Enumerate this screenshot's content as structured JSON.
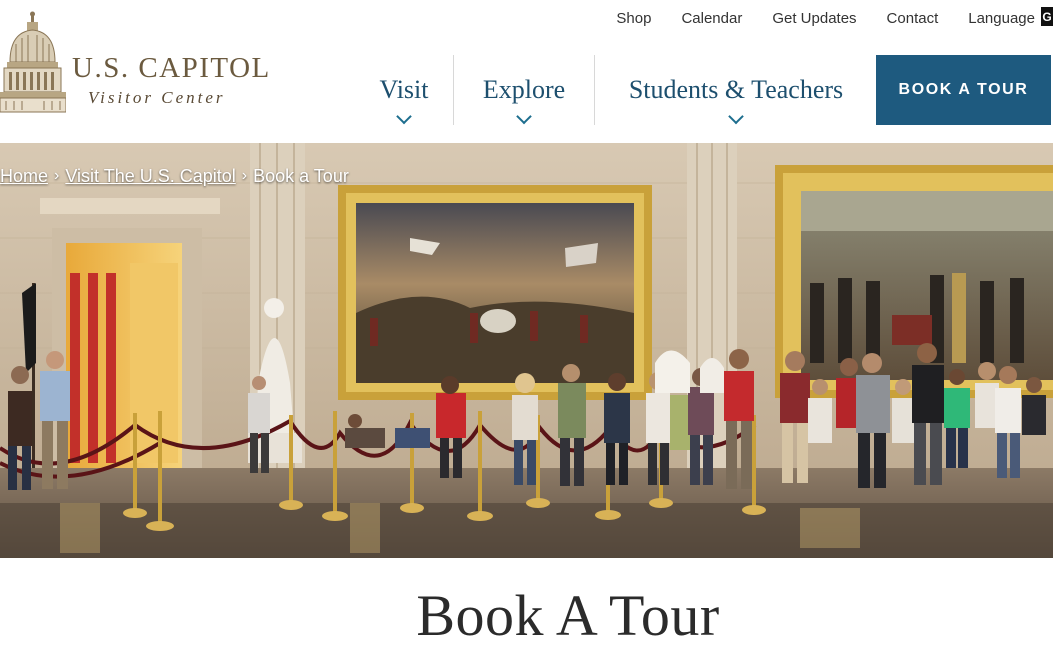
{
  "utility_nav": {
    "shop": "Shop",
    "calendar": "Calendar",
    "get_updates": "Get Updates",
    "contact": "Contact",
    "language": "Language",
    "translate_glyph": "G"
  },
  "logo": {
    "title": "U.S. CAPITOL",
    "subtitle": "Visitor Center"
  },
  "main_nav": {
    "visit": "Visit",
    "explore": "Explore",
    "students_teachers": "Students & Teachers"
  },
  "cta": {
    "book_tour": "BOOK A TOUR"
  },
  "breadcrumb": {
    "home": "Home",
    "visit_capitol": "Visit The U.S. Capitol",
    "current": "Book a Tour",
    "separator": "›"
  },
  "page": {
    "title": "Book A Tour"
  },
  "colors": {
    "brand_blue": "#1e5a7f",
    "nav_text": "#1d4f6e",
    "logo_gold": "#6b5a3f"
  },
  "icons": {
    "dome": "capitol-dome-icon",
    "chevron": "chevron-down-icon",
    "translate": "google-translate-icon"
  }
}
